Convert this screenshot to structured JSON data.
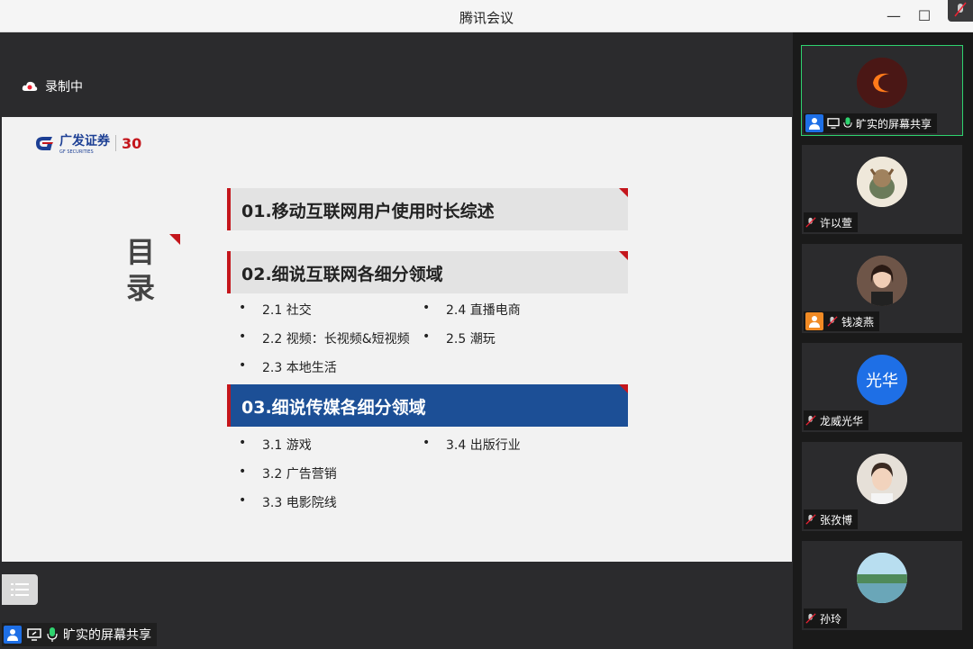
{
  "window": {
    "title": "腾讯会议"
  },
  "recording": {
    "label": "录制中"
  },
  "slide": {
    "logo": {
      "brand": "广发证券",
      "sub": "GF SECURITIES",
      "badge": "30"
    },
    "toc_title": "目录",
    "sections": [
      {
        "label": "01.移动互联网用户使用时长综述",
        "active": false
      },
      {
        "label": "02.细说互联网各细分领域",
        "active": false
      },
      {
        "label": "03.细说传媒各细分领域",
        "active": true
      }
    ],
    "section2_items": [
      "2.1 社交",
      "2.2 视频：长视频&短视频",
      "2.3 本地生活",
      "2.4 直播电商",
      "2.5 潮玩"
    ],
    "section3_items": [
      "3.1 游戏",
      "3.2 广告营销",
      "3.3 电影院线",
      "3.4 出版行业"
    ]
  },
  "share_tag": {
    "label": "旷实的屏幕共享"
  },
  "participants": [
    {
      "name": "旷实的屏幕共享",
      "avatar_text": "",
      "sharing": true
    },
    {
      "name": "许以萱",
      "avatar_text": ""
    },
    {
      "name": "钱凌燕",
      "avatar_text": ""
    },
    {
      "name": "龙威光华",
      "avatar_text": "光华"
    },
    {
      "name": "张孜博",
      "avatar_text": ""
    },
    {
      "name": "孙玲",
      "avatar_text": ""
    }
  ],
  "colors": {
    "accent_red": "#c4161c",
    "active_blue": "#1c4f96",
    "speaking_green": "#2fd36f",
    "avatar_blue": "#1e6fe6"
  }
}
